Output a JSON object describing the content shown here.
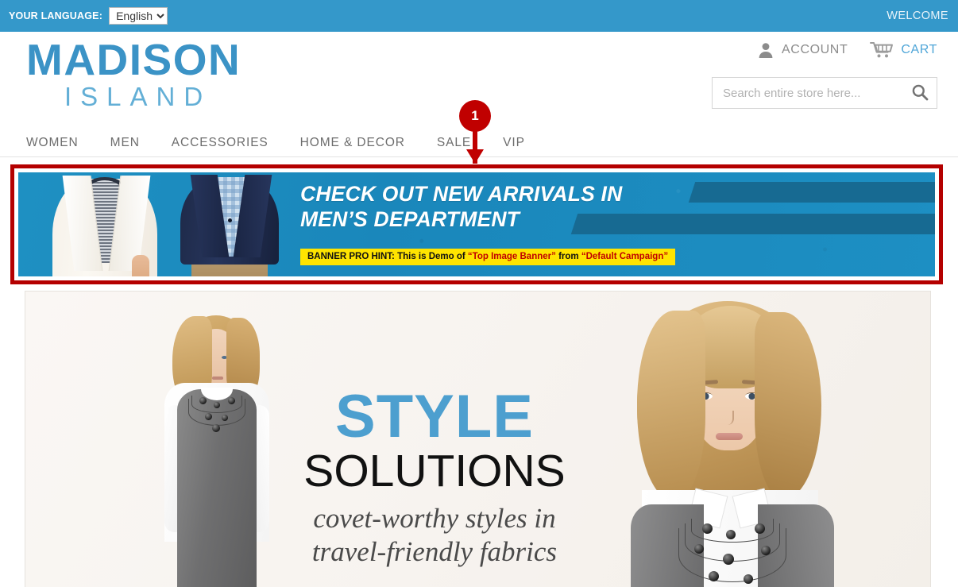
{
  "topbar": {
    "language_label": "YOUR LANGUAGE:",
    "language_value": "English",
    "language_options": [
      "English"
    ],
    "welcome": "WELCOME",
    "background_color": "#3498ca"
  },
  "header": {
    "logo_main": "MADISON",
    "logo_sub": "ISLAND",
    "logo_color": "#3b93c6",
    "account_label": "ACCOUNT",
    "account_icon": "user-icon",
    "cart_label": "CART",
    "cart_icon": "shopping-cart-icon",
    "cart_color": "#4fa6d8",
    "search": {
      "placeholder": "Search entire store here...",
      "value": "",
      "icon": "search-icon"
    }
  },
  "nav": {
    "items": [
      {
        "label": "WOMEN"
      },
      {
        "label": "MEN"
      },
      {
        "label": "ACCESSORIES"
      },
      {
        "label": "HOME & DECOR"
      },
      {
        "label": "SALE"
      },
      {
        "label": "VIP"
      }
    ]
  },
  "annotation": {
    "number": "1",
    "color": "#c00000",
    "points_to": "top-image-banner"
  },
  "banner": {
    "highlight_color": "#b40000",
    "background_color": "#1c8cbe",
    "headline": "CHECK OUT NEW ARRIVALS IN\nMEN’S DEPARTMENT",
    "hint": {
      "prefix": "BANNER PRO HINT: This is Demo of ",
      "highlight_1": "“Top Image Banner”",
      "middle": " from ",
      "highlight_2": "“Default Campaign”",
      "background_color": "#ffe400",
      "highlight_color": "#c00000"
    }
  },
  "hero": {
    "title_1": "STYLE",
    "title_1_color": "#4d9fcf",
    "title_2": "SOLUTIONS",
    "tagline_1": "covet-worthy styles in",
    "tagline_2": "travel-friendly fabrics"
  }
}
